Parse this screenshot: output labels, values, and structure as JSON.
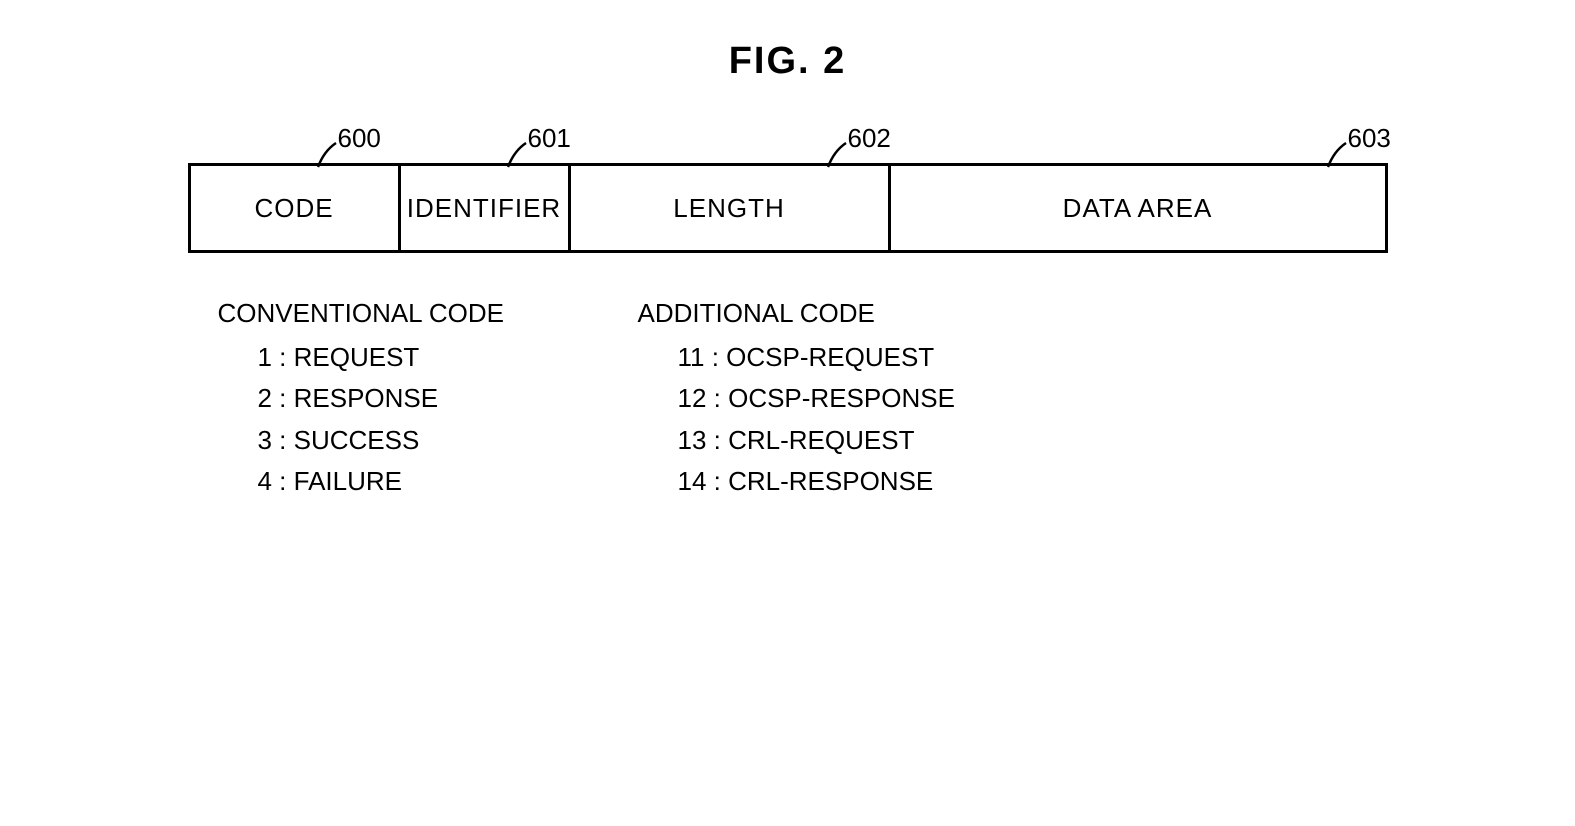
{
  "figure_title": "FIG. 2",
  "fields": {
    "code": {
      "label": "CODE",
      "ref": "600"
    },
    "identifier": {
      "label": "IDENTIFIER",
      "ref": "601"
    },
    "length": {
      "label": "LENGTH",
      "ref": "602"
    },
    "data_area": {
      "label": "DATA AREA",
      "ref": "603"
    }
  },
  "codes": {
    "conventional": {
      "heading": "CONVENTIONAL CODE",
      "items": [
        "1 : REQUEST",
        "2 : RESPONSE",
        "3 : SUCCESS",
        "4 : FAILURE"
      ]
    },
    "additional": {
      "heading": "ADDITIONAL CODE",
      "items": [
        "11 : OCSP-REQUEST",
        "12 : OCSP-RESPONSE",
        "13 : CRL-REQUEST",
        "14 : CRL-RESPONSE"
      ]
    }
  }
}
